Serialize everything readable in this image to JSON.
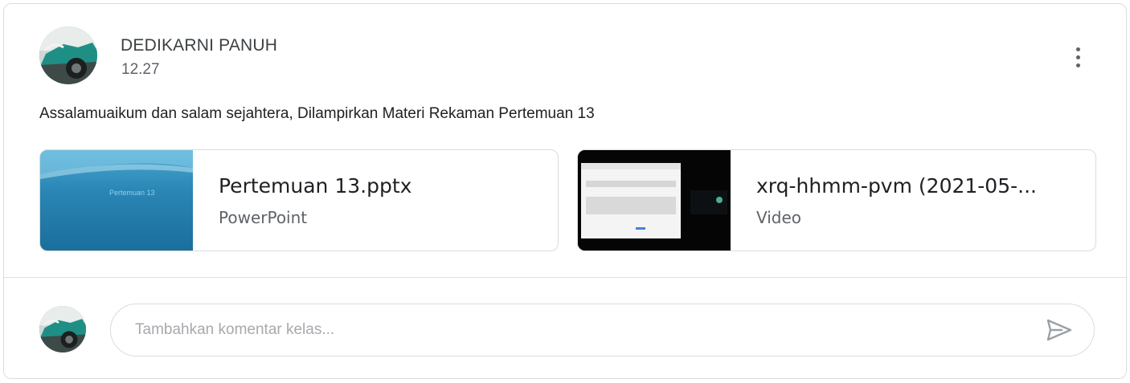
{
  "post": {
    "author": "DEDIKARNI PANUH",
    "time": "12.27",
    "message": "Assalamuaikum dan salam sejahtera, Dilampirkan Materi Rekaman Pertemuan 13"
  },
  "attachments": [
    {
      "name": "Pertemuan 13.pptx",
      "type": "PowerPoint",
      "thumbnail_text": "Pertemuan 13"
    },
    {
      "name": "xrq-hhmm-pvm (2021-05-...",
      "type": "Video"
    }
  ],
  "comment": {
    "placeholder": "Tambahkan komentar kelas..."
  },
  "icons": {
    "more": "more-vert-icon",
    "send": "send-icon"
  },
  "colors": {
    "text_primary": "#202124",
    "text_secondary": "#5f6368",
    "border": "#dadce0",
    "placeholder": "#a7a9ad"
  }
}
